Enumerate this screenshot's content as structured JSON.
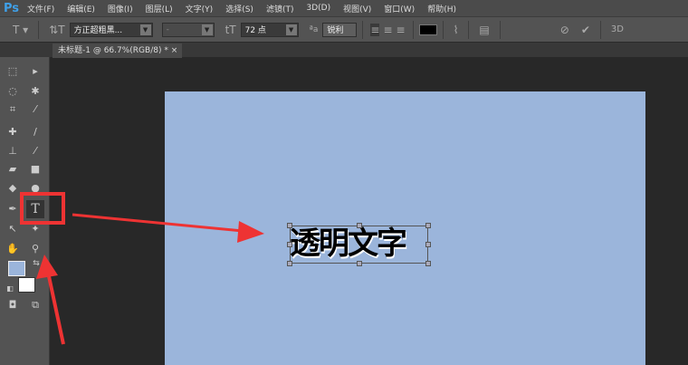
{
  "app": {
    "logo": "Ps"
  },
  "menu": [
    "文件(F)",
    "编辑(E)",
    "图像(I)",
    "图层(L)",
    "文字(Y)",
    "选择(S)",
    "滤镜(T)",
    "3D(D)",
    "视图(V)",
    "窗口(W)",
    "帮助(H)"
  ],
  "options": {
    "font_family": "方正超粗黑...",
    "font_style": "-",
    "font_size": "72 点",
    "antialias": "锐利",
    "label_3d": "3D",
    "text_color": "#000000"
  },
  "document": {
    "tab_title": "未标题-1 @ 66.7%(RGB/8) *",
    "close": "×",
    "canvas_color": "#9bb5db",
    "text": "透明文字"
  },
  "colors": {
    "foreground": "#9bb5db",
    "background": "#ffffff",
    "annotation": "#ee3333"
  }
}
